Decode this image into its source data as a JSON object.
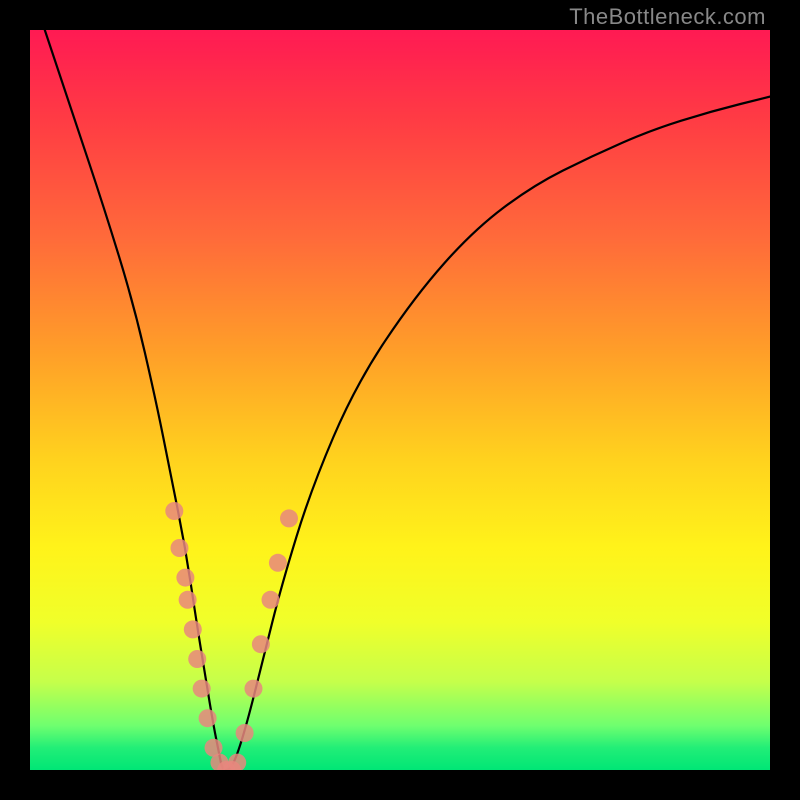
{
  "watermark": "TheBottleneck.com",
  "colors": {
    "frame": "#000000",
    "curve": "#000000",
    "marker": "#e8877e",
    "gradient_top": "#ff1a53",
    "gradient_bottom": "#00e676"
  },
  "chart_data": {
    "type": "line",
    "title": "",
    "xlabel": "",
    "ylabel": "",
    "xlim": [
      0,
      100
    ],
    "ylim": [
      0,
      100
    ],
    "grid": false,
    "legend": false,
    "series": [
      {
        "name": "bottleneck-curve",
        "x": [
          2,
          6,
          10,
          14,
          17,
          19,
          21,
          22.5,
          23.8,
          24.8,
          25.6,
          26,
          27,
          28,
          29.5,
          31.5,
          34,
          38,
          44,
          52,
          60,
          68,
          76,
          84,
          92,
          100
        ],
        "y": [
          100,
          88,
          76,
          63,
          50,
          40,
          30,
          20,
          12,
          6,
          2,
          0,
          0,
          2,
          7,
          15,
          25,
          38,
          52,
          64,
          73,
          79,
          83,
          86.5,
          89,
          91
        ]
      }
    ],
    "markers": {
      "name": "highlighted-points",
      "points": [
        {
          "x": 19.5,
          "y": 35
        },
        {
          "x": 20.2,
          "y": 30
        },
        {
          "x": 21.0,
          "y": 26
        },
        {
          "x": 21.3,
          "y": 23
        },
        {
          "x": 22.0,
          "y": 19
        },
        {
          "x": 22.6,
          "y": 15
        },
        {
          "x": 23.2,
          "y": 11
        },
        {
          "x": 24.0,
          "y": 7
        },
        {
          "x": 24.8,
          "y": 3
        },
        {
          "x": 25.6,
          "y": 1
        },
        {
          "x": 26.5,
          "y": 0
        },
        {
          "x": 27.3,
          "y": 0
        },
        {
          "x": 28.0,
          "y": 1
        },
        {
          "x": 29.0,
          "y": 5
        },
        {
          "x": 30.2,
          "y": 11
        },
        {
          "x": 31.2,
          "y": 17
        },
        {
          "x": 32.5,
          "y": 23
        },
        {
          "x": 33.5,
          "y": 28
        },
        {
          "x": 35.0,
          "y": 34
        }
      ]
    }
  }
}
